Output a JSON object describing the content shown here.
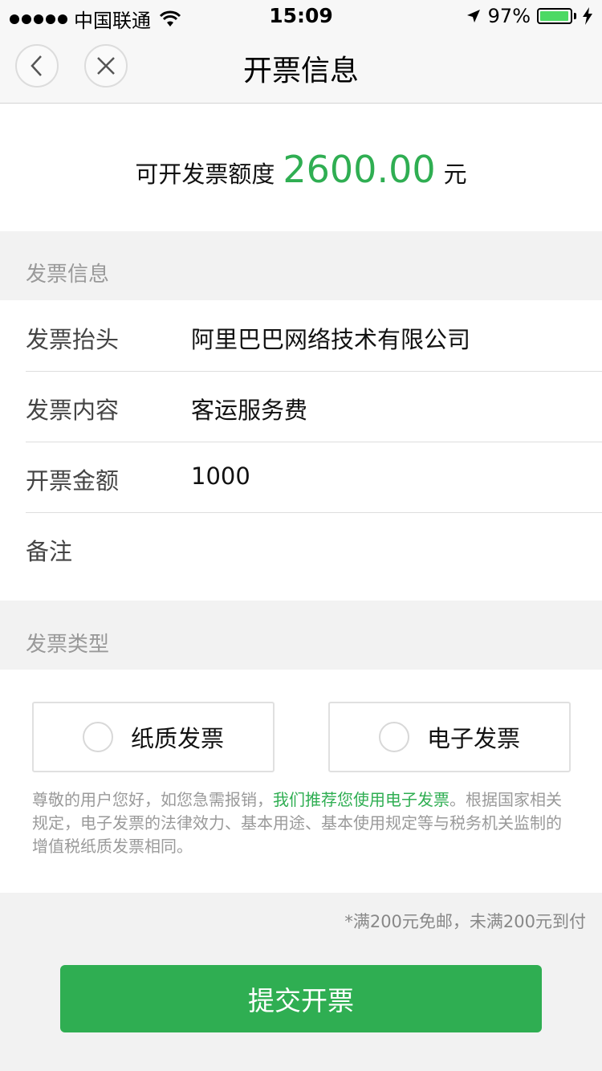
{
  "status_bar": {
    "carrier": "中国联通",
    "time": "15:09",
    "battery": "97%",
    "battery_level": 0.97
  },
  "nav": {
    "title": "开票信息",
    "back_icon": "chevron-left-icon",
    "close_icon": "close-icon"
  },
  "quota": {
    "label": "可开发票额度",
    "amount": "2600.00",
    "unit": "元",
    "accent_color": "#2fae52"
  },
  "invoice_info": {
    "header": "发票信息",
    "rows": [
      {
        "label": "发票抬头",
        "value": "阿里巴巴网络技术有限公司"
      },
      {
        "label": "发票内容",
        "value": "客运服务费"
      },
      {
        "label": "开票金额",
        "value": "1000"
      },
      {
        "label": "备注",
        "value": ""
      }
    ]
  },
  "invoice_type": {
    "header": "发票类型",
    "options": [
      {
        "label": "纸质发票"
      },
      {
        "label": "电子发票"
      }
    ],
    "notice_part1": "尊敬的用户您好，如您急需报销，",
    "notice_highlight": "我们推荐您使用电子发票",
    "notice_part2": "。根据国家相关规定，电子发票的法律效力、基本用途、基本使用规定等与税务机关监制的增值税纸质发票相同。"
  },
  "shipping_note": "*满200元免邮，未满200元到付",
  "submit_label": "提交开票"
}
